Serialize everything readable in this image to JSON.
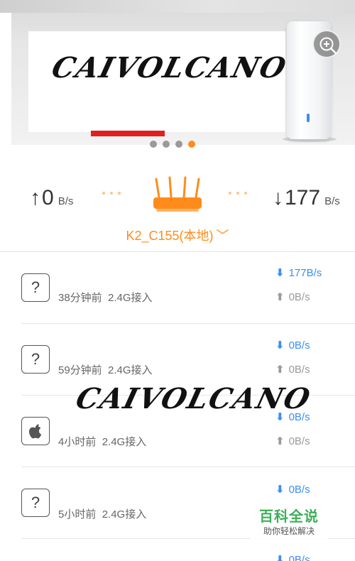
{
  "watermark_text": "CAIVOLCANO",
  "speed": {
    "upload_arrow": "↑",
    "upload_value": "0",
    "upload_unit": "B/s",
    "download_arrow": "↓",
    "download_value": "177",
    "download_unit": "B/s",
    "router_name": "K2_C155(本地)",
    "router_chevron": "﹀"
  },
  "carousel": {
    "page_count": 4,
    "active_page": 4
  },
  "devices": [
    {
      "icon": "?",
      "time": "38分钟前",
      "band": "2.4G接入",
      "download": "177B/s",
      "upload": "0B/s"
    },
    {
      "icon": "?",
      "time": "59分钟前",
      "band": "2.4G接入",
      "download": "0B/s",
      "upload": "0B/s"
    },
    {
      "icon": "apple",
      "time": "4小时前",
      "band": "2.4G接入",
      "download": "0B/s",
      "upload": "0B/s"
    },
    {
      "icon": "?",
      "time": "5小时前",
      "band": "2.4G接入",
      "download": "0B/s",
      "upload": "0B/s"
    },
    {
      "icon": "?",
      "time": "",
      "band": "",
      "download": "0B/s",
      "upload": ""
    }
  ],
  "arrows": {
    "down": "⬇",
    "up": "⬆"
  },
  "baike": {
    "title": "百科全说",
    "subtitle": "助你轻松解决"
  },
  "colors": {
    "accent": "#ff8c1a",
    "download_blue": "#3a8ef0",
    "baike_green": "#3cb05a"
  }
}
